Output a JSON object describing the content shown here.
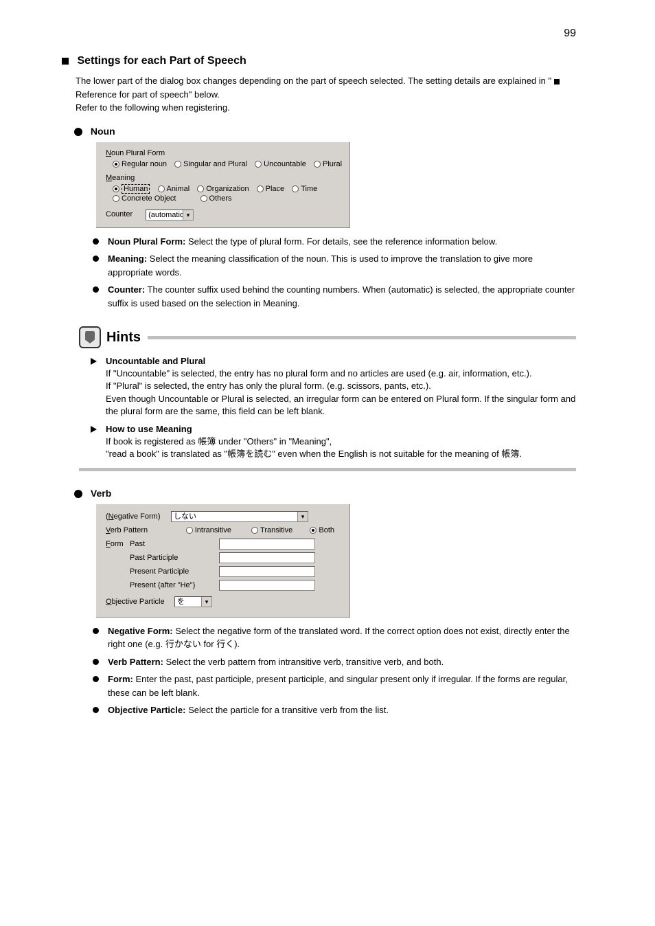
{
  "page_number": "99",
  "section1": {
    "title": "Settings for each Part of Speech",
    "body_pre": "The lower part of the dialog box changes depending on the part of speech selected. The setting details are explained in \"",
    "body_ref_mark": "■",
    "body_ref": "Reference for part of speech\" below.",
    "body_post": "Refer to the following when registering."
  },
  "noun": {
    "heading": "Noun",
    "panel": {
      "plural_label": "Noun Plural Form",
      "plural_options": [
        "Regular noun",
        "Singular and Plural",
        "Uncountable",
        "Plural"
      ],
      "plural_selected": 0,
      "meaning_label": "Meaning",
      "meaning_options": [
        "Human",
        "Animal",
        "Organization",
        "Place",
        "Time",
        "Concrete Object",
        "Others"
      ],
      "meaning_selected": 0,
      "counter_label": "Counter",
      "counter_value": "(automatic)"
    },
    "b1_bold": "Noun Plural Form:",
    "b1_rest": " Select the type of plural form. For details, see the reference information below.",
    "b2_bold": "Meaning:",
    "b2_rest": " Select the meaning classification of the noun. This is used to improve the translation to give more appropriate words.",
    "b3_bold": "Counter:",
    "b3_rest": " The counter suffix used behind the counting numbers. When (automatic) is selected, the appropriate counter suffix is used based on the selection in Meaning."
  },
  "hints": {
    "label": "Hints",
    "h1_l1": "Uncountable and Plural",
    "h1_l2": "If \"Uncountable\" is selected, the entry has no plural form and no articles are used (e.g. air, information, etc.).",
    "h1_l3": "If \"Plural\" is selected, the entry has only the plural form. (e.g. scissors, pants, etc.).",
    "h1_l4": "Even though Uncountable or Plural is selected, an irregular form can be entered on Plural form. If the singular form and the plural form are the same, this field can be left blank.",
    "h2_l1": "How to use Meaning",
    "h2_l2_pre": "If book is registered as ",
    "h2_jp": "帳簿",
    "h2_l2_mid": " under \"Others\" in \"Meaning\",",
    "h2_l3_pre": "\"read a book\" is translated as \"",
    "h2_l3_post": "を読む\" even when the English is not suitable for the meaning of 帳簿."
  },
  "verb": {
    "heading": "Verb",
    "panel": {
      "neg_label": "(Negative Form)",
      "neg_value": "しない",
      "pattern_label": "Verb Pattern",
      "pattern_options": [
        "Intransitive",
        "Transitive",
        "Both"
      ],
      "pattern_selected": 2,
      "form_label": "Form",
      "form_rows": [
        "Past",
        "Past Participle",
        "Present Participle",
        "Present (after \"He\")"
      ],
      "obj_label": "Objective Particle",
      "obj_value": "を"
    },
    "b1_bold": "Negative Form:",
    "b1_rest": " Select the negative form of the translated word. If the correct option does not exist, directly enter the right one (e.g. 行かない for 行く).",
    "b2_bold": "Verb Pattern:",
    "b2_rest": " Select the verb pattern from intransitive verb, transitive verb, and both.",
    "b3_bold": "Form:",
    "b3_rest": " Enter the past, past participle, present participle, and singular present only if irregular. If the forms are regular, these can be left blank.",
    "b4_bold": "Objective Particle:",
    "b4_rest": " Select the particle for a transitive verb from the list."
  }
}
